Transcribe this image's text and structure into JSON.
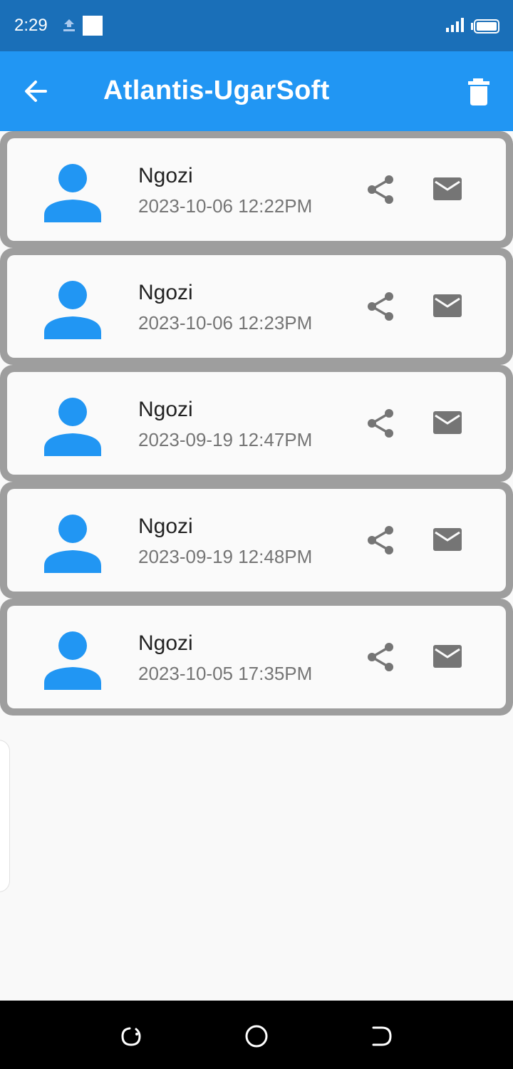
{
  "status_bar": {
    "time": "2:29"
  },
  "app_bar": {
    "title": "Atlantis-UgarSoft"
  },
  "colors": {
    "primary": "#2196f3",
    "status_bar": "#1a6fb8",
    "icon_gray": "#757575"
  },
  "items": [
    {
      "name": "Ngozi",
      "date": "2023-10-06 12:22PM"
    },
    {
      "name": "Ngozi",
      "date": "2023-10-06 12:23PM"
    },
    {
      "name": "Ngozi",
      "date": "2023-09-19 12:47PM"
    },
    {
      "name": "Ngozi",
      "date": "2023-09-19 12:48PM"
    },
    {
      "name": "Ngozi",
      "date": "2023-10-05 17:35PM"
    }
  ]
}
